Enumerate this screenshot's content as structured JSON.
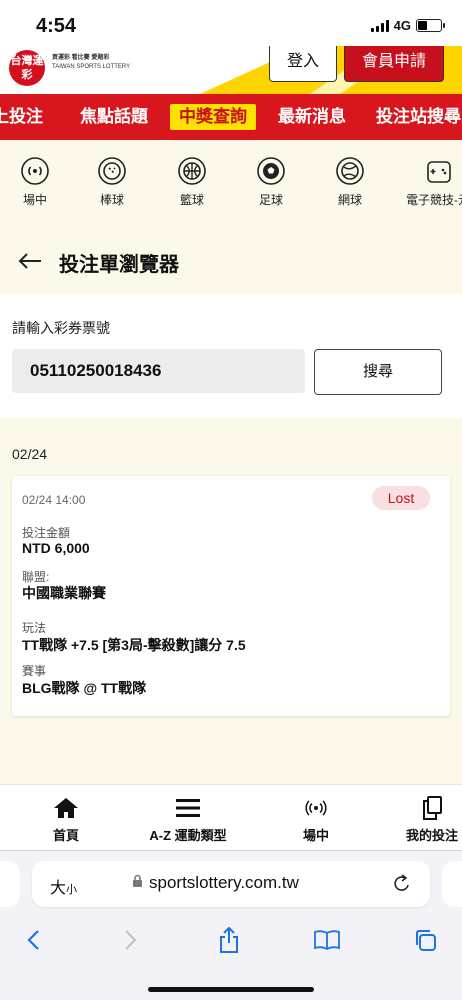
{
  "status_bar": {
    "time": "4:54",
    "network": "4G"
  },
  "header": {
    "logo_text": "台灣運彩",
    "logo_small_1": "買運彩 看比賽 愛賭彩",
    "logo_small_2": "TAIWAN SPORTS LOTTERY",
    "login_label": "登入",
    "register_label": "會員申請",
    "colors": {
      "brand_red": "#d7161e",
      "accent_yellow": "#ffe100"
    }
  },
  "nav": {
    "items": [
      {
        "label": "上投注"
      },
      {
        "label": "焦點話題"
      },
      {
        "label": "中獎查詢",
        "active": true
      },
      {
        "label": "最新消息"
      },
      {
        "label": "投注站搜尋"
      }
    ]
  },
  "sports": [
    {
      "label": "場中",
      "icon": "live-icon"
    },
    {
      "label": "棒球",
      "icon": "baseball-icon"
    },
    {
      "label": "籃球",
      "icon": "basketball-icon"
    },
    {
      "label": "足球",
      "icon": "soccer-icon"
    },
    {
      "label": "網球",
      "icon": "tennis-icon"
    },
    {
      "label": "電子競技-元",
      "icon": "esports-icon"
    }
  ],
  "page": {
    "title": "投注單瀏覽器"
  },
  "search": {
    "label": "請輸入彩券票號",
    "value": "05110250018436",
    "button_label": "搜尋"
  },
  "results": {
    "date_heading": "02/24",
    "card": {
      "time": "02/24 14:00",
      "status": "Lost",
      "amount_label": "投注金額",
      "amount_value": "NTD 6,000",
      "league_label": "聯盟:",
      "league_value": "中國職業聯賽",
      "play_label": "玩法",
      "play_value": "TT戰隊 +7.5 [第3局-擊殺數]讓分 7.5",
      "match_label": "賽事",
      "match_value": "BLG戰隊 @ TT戰隊"
    }
  },
  "tabbar": [
    {
      "label": "首頁",
      "icon": "home-icon"
    },
    {
      "label": "A-Z 運動類型",
      "icon": "menu-icon"
    },
    {
      "label": "場中",
      "icon": "live-icon"
    },
    {
      "label": "我的投注",
      "icon": "copy-icon"
    }
  ],
  "browser": {
    "text_size_label": "大",
    "text_size_small": "小",
    "url": "sportslottery.com.tw"
  }
}
